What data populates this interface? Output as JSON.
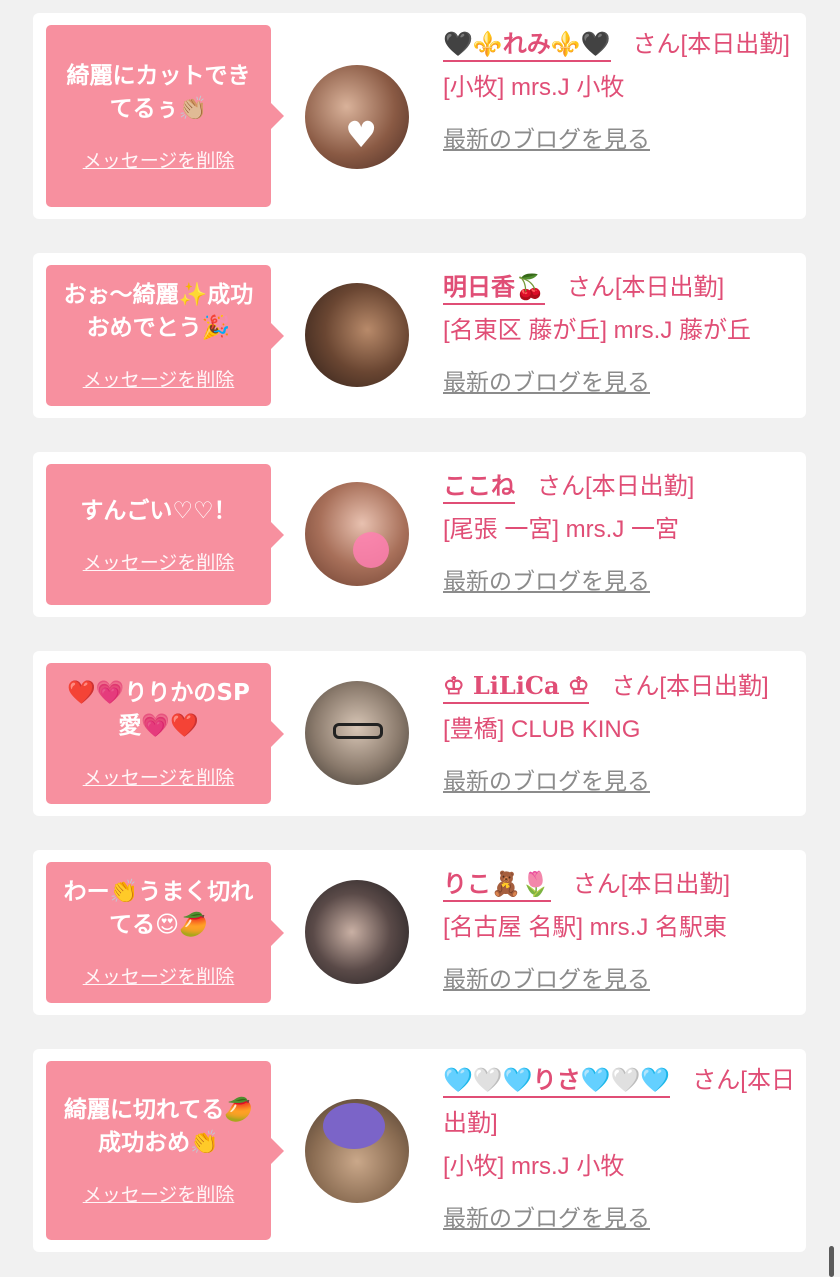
{
  "colors": {
    "bubble": "#f7909f",
    "accent": "#e04e76",
    "link_gray": "#8b8b8b",
    "background": "#f1f1f1"
  },
  "common": {
    "delete_label": "メッセージを削除",
    "blog_label": "最新のブログを見る"
  },
  "messages": [
    {
      "message": "綺麗にカットでき\nてるぅ👏🏼",
      "cast_name": "🖤⚜️れみ⚜️🖤",
      "suffix": "さん[本日出勤]",
      "shop": "[小牧] mrs.J 小牧",
      "avatar_colors": [
        "#d9b29a",
        "#4a2c24"
      ]
    },
    {
      "message": "おぉ〜綺麗✨成功\nおめでとう🎉",
      "cast_name": "明日香🍒",
      "suffix": "さん[本日出勤]",
      "shop": "[名東区 藤が丘] mrs.J 藤が丘",
      "avatar_colors": [
        "#b88a6a",
        "#2d1e18"
      ]
    },
    {
      "message": "すんごい♡♡！",
      "cast_name": "ここね",
      "suffix": "さん[本日出勤]",
      "shop": "[尾張 一宮] mrs.J 一宮",
      "avatar_colors": [
        "#e8c1b0",
        "#6a3d2e"
      ]
    },
    {
      "message": "❤️💗りりかのSP\n愛💗❤️",
      "cast_name": "♔ LiLiCa ♔",
      "suffix": "さん[本日出勤]",
      "shop": "[豊橋] CLUB KING",
      "avatar_colors": [
        "#d8c6b6",
        "#3a342e"
      ]
    },
    {
      "message": "わー👏うまく切れ\nてる😍🥭",
      "cast_name": "りこ🧸🌷",
      "suffix": "さん[本日出勤]",
      "shop": "[名古屋 名駅] mrs.J 名駅東",
      "avatar_colors": [
        "#c9b0a4",
        "#1e1c1e"
      ]
    },
    {
      "message": "綺麗に切れてる🥭\n成功おめ👏",
      "cast_name": "🩵🤍🩵りさ🩵🤍🩵",
      "suffix": "さん[本日出勤]",
      "shop": "[小牧] mrs.J 小牧",
      "avatar_colors": [
        "#caa88a",
        "#7b64c8"
      ]
    }
  ]
}
